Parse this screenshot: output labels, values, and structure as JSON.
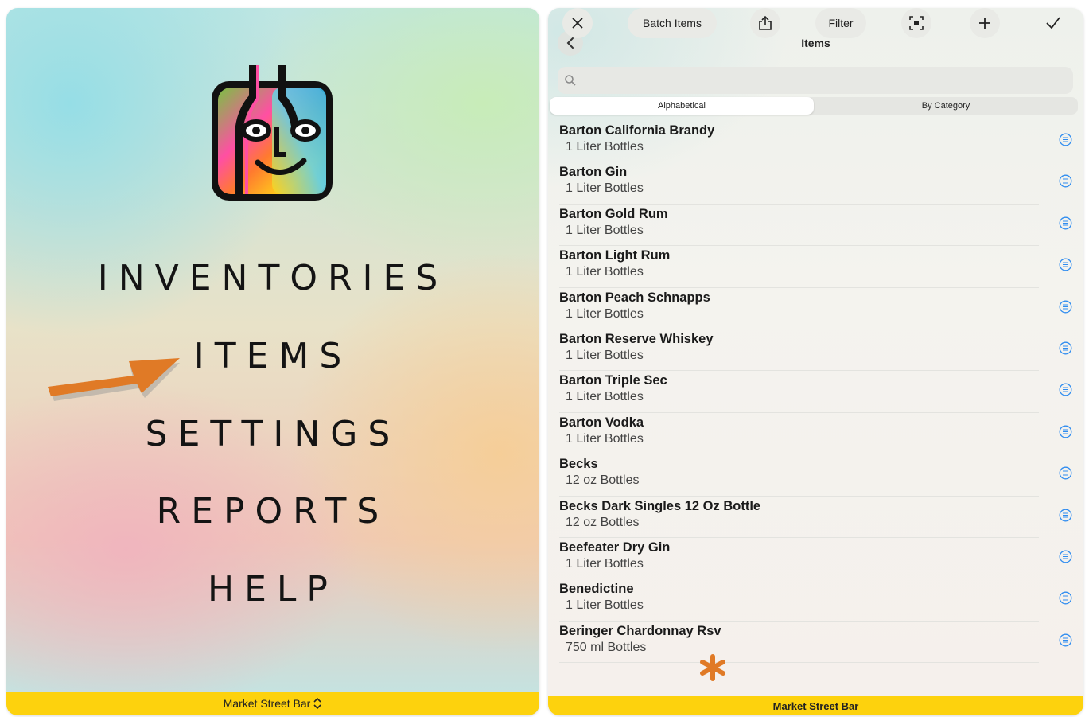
{
  "left": {
    "menu": [
      "INVENTORIES",
      "ITEMS",
      "SETTINGS",
      "REPORTS",
      "HELP"
    ],
    "footer_label": "Market Street Bar",
    "footer_icon": "chevron-up-down-icon",
    "arrow_color": "#e07a26"
  },
  "right": {
    "title": "Items",
    "search_placeholder": "",
    "segments": [
      "Alphabetical",
      "By Category"
    ],
    "selected_segment": "Alphabetical",
    "items": [
      {
        "name": "Barton California Brandy",
        "unit": "1 Liter Bottles"
      },
      {
        "name": "Barton Gin",
        "unit": "1 Liter Bottles"
      },
      {
        "name": "Barton Gold Rum",
        "unit": "1 Liter Bottles"
      },
      {
        "name": "Barton Light Rum",
        "unit": "1 Liter Bottles"
      },
      {
        "name": "Barton Peach Schnapps",
        "unit": "1 Liter Bottles"
      },
      {
        "name": "Barton Reserve Whiskey",
        "unit": "1 Liter Bottles"
      },
      {
        "name": "Barton Triple Sec",
        "unit": "1 Liter Bottles"
      },
      {
        "name": "Barton Vodka",
        "unit": "1 Liter Bottles"
      },
      {
        "name": "Becks",
        "unit": "12 oz Bottles"
      },
      {
        "name": "Becks Dark Singles 12 Oz Bottle",
        "unit": "12 oz Bottles"
      },
      {
        "name": "Beefeater Dry Gin",
        "unit": "1 Liter Bottles"
      },
      {
        "name": "Benedictine",
        "unit": "1 Liter Bottles"
      },
      {
        "name": "Beringer Chardonnay Rsv",
        "unit": "750 ml Bottles"
      }
    ],
    "toolbar": {
      "batch_label": "Batch Items",
      "filter_label": "Filter"
    },
    "footer_label": "Market Street Bar",
    "accent_color": "#2e8cf0",
    "footer_color": "#fdd20d"
  }
}
